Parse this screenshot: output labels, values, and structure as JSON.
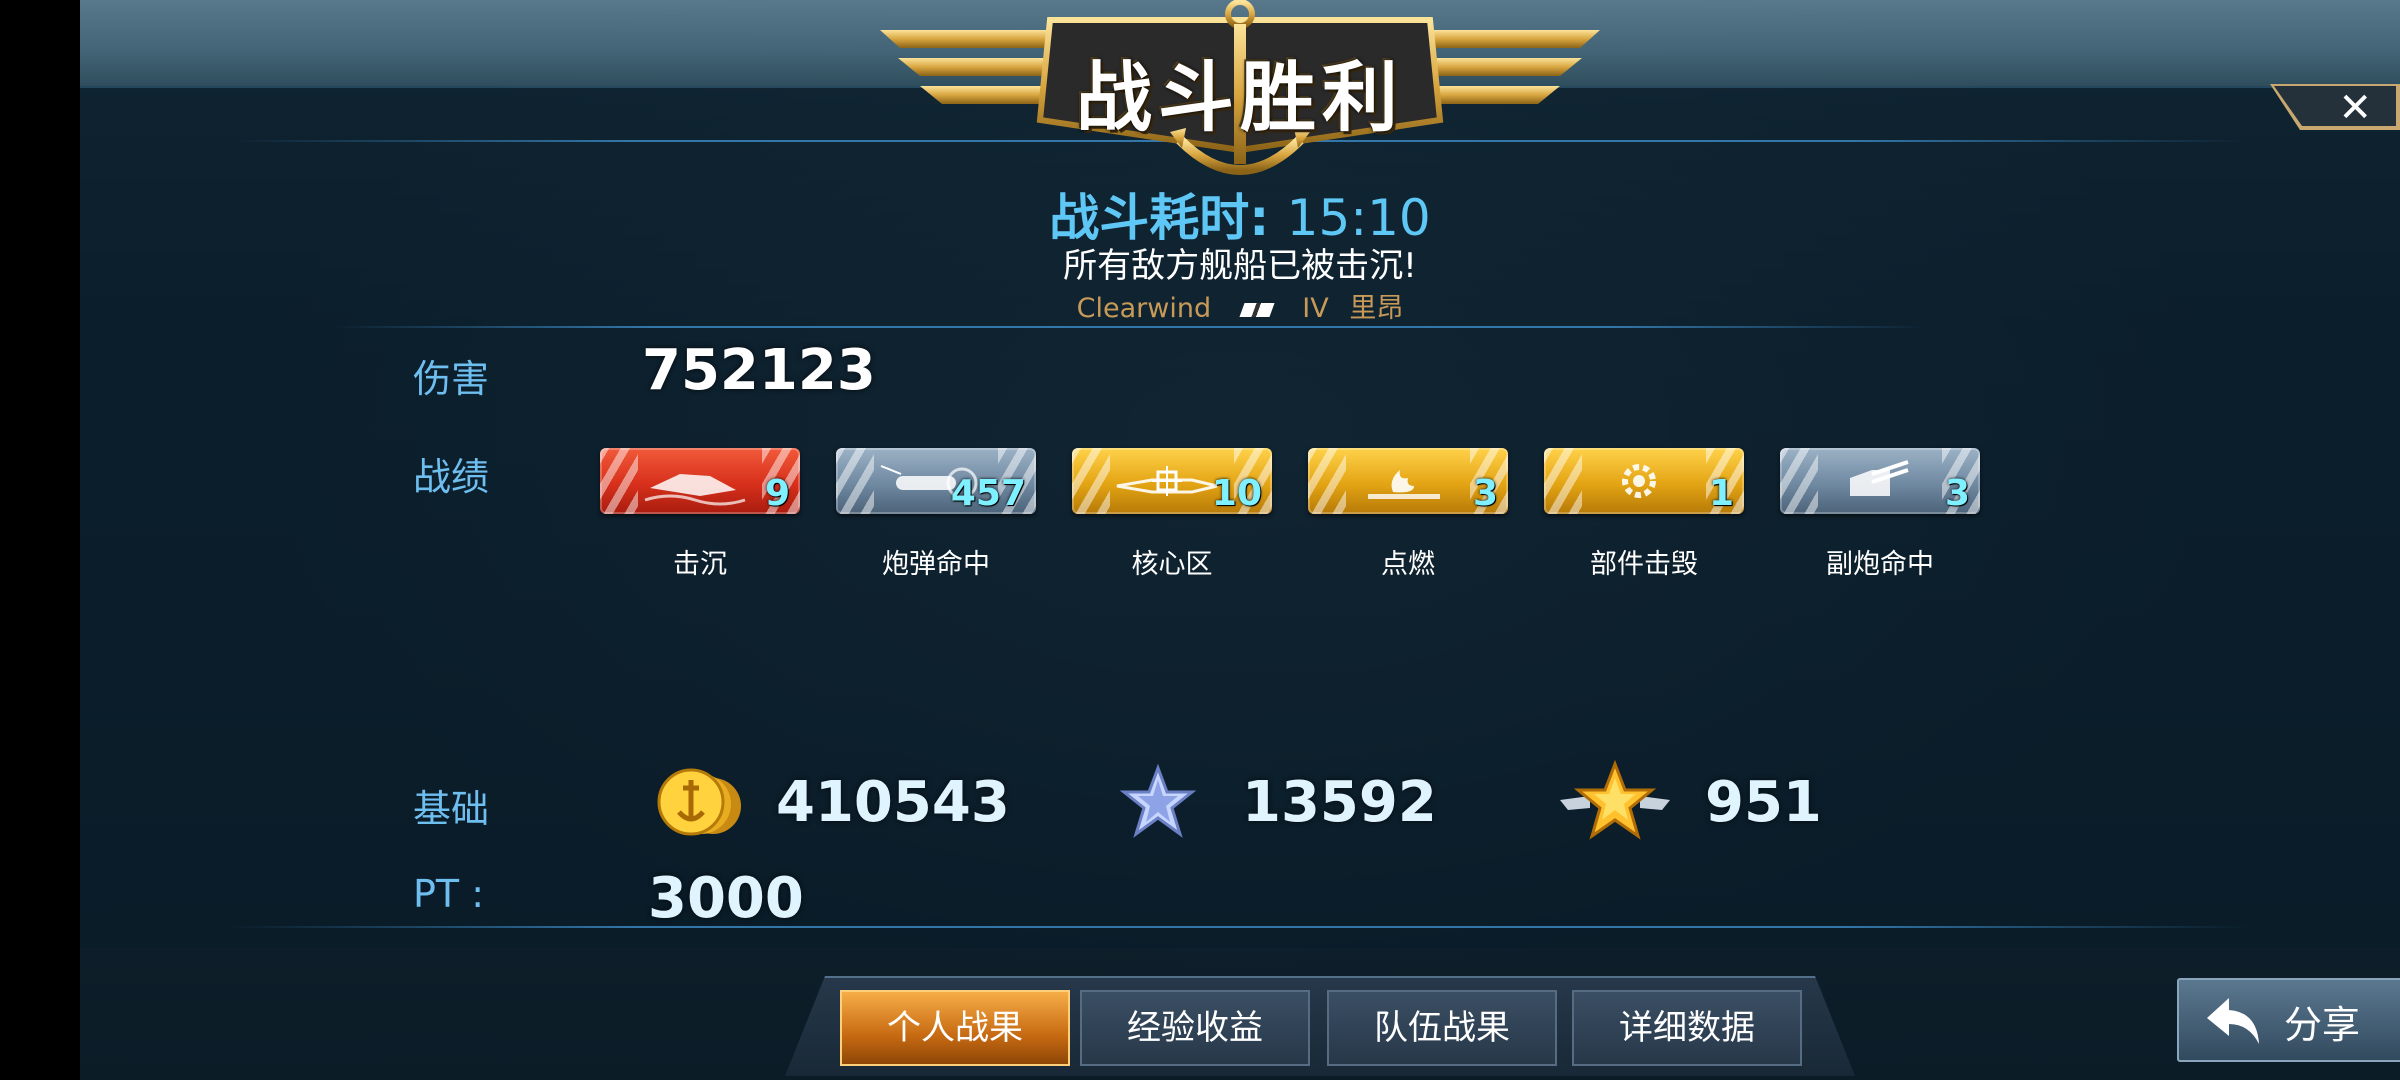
{
  "header": {
    "title": "战斗胜利",
    "close_icon": "close-icon"
  },
  "battle": {
    "time_label": "战斗耗时:",
    "time_value": "15:10",
    "result_message": "所有敌方舰船已被击沉!",
    "ship_name": "Clearwind",
    "ship_tier": "IV",
    "ship_class": "里昂"
  },
  "damage": {
    "label": "伤害",
    "value": "752123"
  },
  "achievements": {
    "label": "战绩",
    "items": [
      {
        "name": "击沉",
        "count": "9",
        "color": "red",
        "icon": "sunk-ship-icon"
      },
      {
        "name": "炮弹命中",
        "count": "457",
        "color": "steel",
        "icon": "shell-icon"
      },
      {
        "name": "核心区",
        "count": "10",
        "color": "gold",
        "icon": "citadel-icon"
      },
      {
        "name": "点燃",
        "count": "3",
        "color": "gold",
        "icon": "fire-icon"
      },
      {
        "name": "部件击毁",
        "count": "1",
        "color": "gold",
        "icon": "gear-icon"
      },
      {
        "name": "副炮命中",
        "count": "3",
        "color": "steel",
        "icon": "secondary-gun-icon"
      }
    ]
  },
  "base": {
    "label": "基础",
    "coins": "410543",
    "silver_exp": "13592",
    "gold_exp": "951"
  },
  "pt": {
    "label": "PT :",
    "value": "3000"
  },
  "tabs": [
    {
      "label": "个人战果",
      "active": true
    },
    {
      "label": "经验收益",
      "active": false
    },
    {
      "label": "队伍战果",
      "active": false
    },
    {
      "label": "详细数据",
      "active": false
    }
  ],
  "share": {
    "label": "分享",
    "icon": "share-arrow-icon"
  },
  "colors": {
    "accent_blue": "#6fbef0",
    "title_gold": "#e2b85a",
    "tab_active": "#e08a24"
  }
}
